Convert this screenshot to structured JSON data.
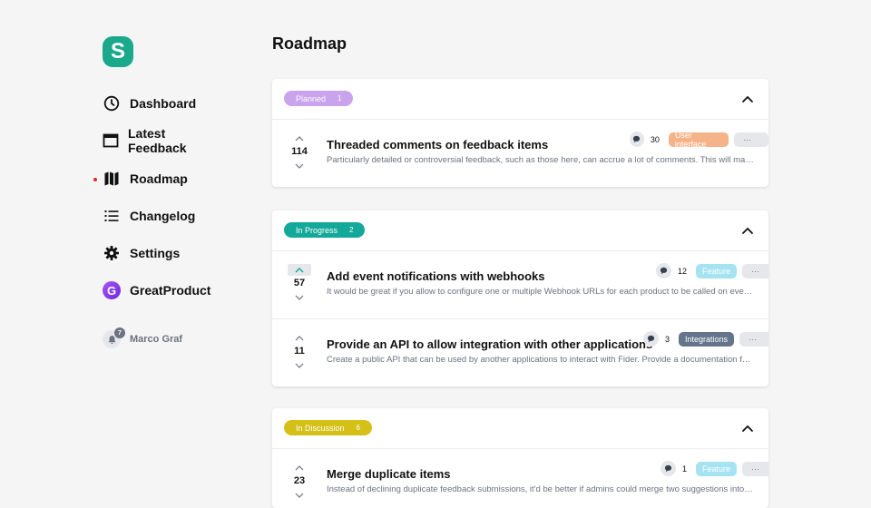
{
  "app": {
    "logo_letter": "S",
    "brand_color": "#1aa98b"
  },
  "sidebar": {
    "items": [
      {
        "label": "Dashboard",
        "icon": "dashboard-icon"
      },
      {
        "label": "Latest Feedback",
        "icon": "calendar-icon"
      },
      {
        "label": "Roadmap",
        "icon": "roadmap-icon",
        "active": true
      },
      {
        "label": "Changelog",
        "icon": "list-icon"
      },
      {
        "label": "Settings",
        "icon": "gear-icon"
      },
      {
        "label": "GreatProduct",
        "icon": "organization-icon",
        "icon_letter": "G"
      }
    ],
    "user": {
      "name": "Marco Graf",
      "notification_count": "7"
    }
  },
  "main": {
    "title": "Roadmap",
    "sections": [
      {
        "status": "Planned",
        "count": "1",
        "pill_bg": "#c9a3ec",
        "pill_fg": "#ffffff",
        "items": [
          {
            "votes": "114",
            "title": "Threaded comments on feedback items",
            "description": "Particularly detailed or controversial feedback, such as those here, can accrue a lot of comments. This will make it harder to follow the discussion.",
            "comments": "30",
            "tag": "User interface",
            "tag_bg": "#f5b38a",
            "tag_fg": "#ffffff"
          }
        ]
      },
      {
        "status": "In Progress",
        "count": "2",
        "pill_bg": "#14a89a",
        "pill_fg": "#ffffff",
        "items": [
          {
            "votes": "57",
            "voted": true,
            "title": "Add event notifications with webhooks",
            "description": "It would be great if you allow to configure one or multiple Webhook URLs for each product to be called on events.",
            "comments": "12",
            "tag": "Feature",
            "tag_bg": "#a5e3f3",
            "tag_fg": "#ffffff"
          },
          {
            "votes": "11",
            "title": "Provide an API to allow integration with other applications",
            "description": "Create a public API that can be used by another applications to interact with Fider. Provide a documentation for developers.",
            "comments": "3",
            "tag": "Integrations",
            "tag_bg": "#64748b",
            "tag_fg": "#ffffff"
          }
        ]
      },
      {
        "status": "In Discussion",
        "count": "6",
        "pill_bg": "#d4c017",
        "pill_fg": "#ffffff",
        "items": [
          {
            "votes": "23",
            "title": "Merge duplicate items",
            "description": "Instead of declining duplicate feedback submissions, it'd be better if admins could merge two suggestions into one item.",
            "comments": "1",
            "tag": "Feature",
            "tag_bg": "#a5e3f3",
            "tag_fg": "#ffffff"
          }
        ]
      }
    ],
    "more_label": "···"
  }
}
